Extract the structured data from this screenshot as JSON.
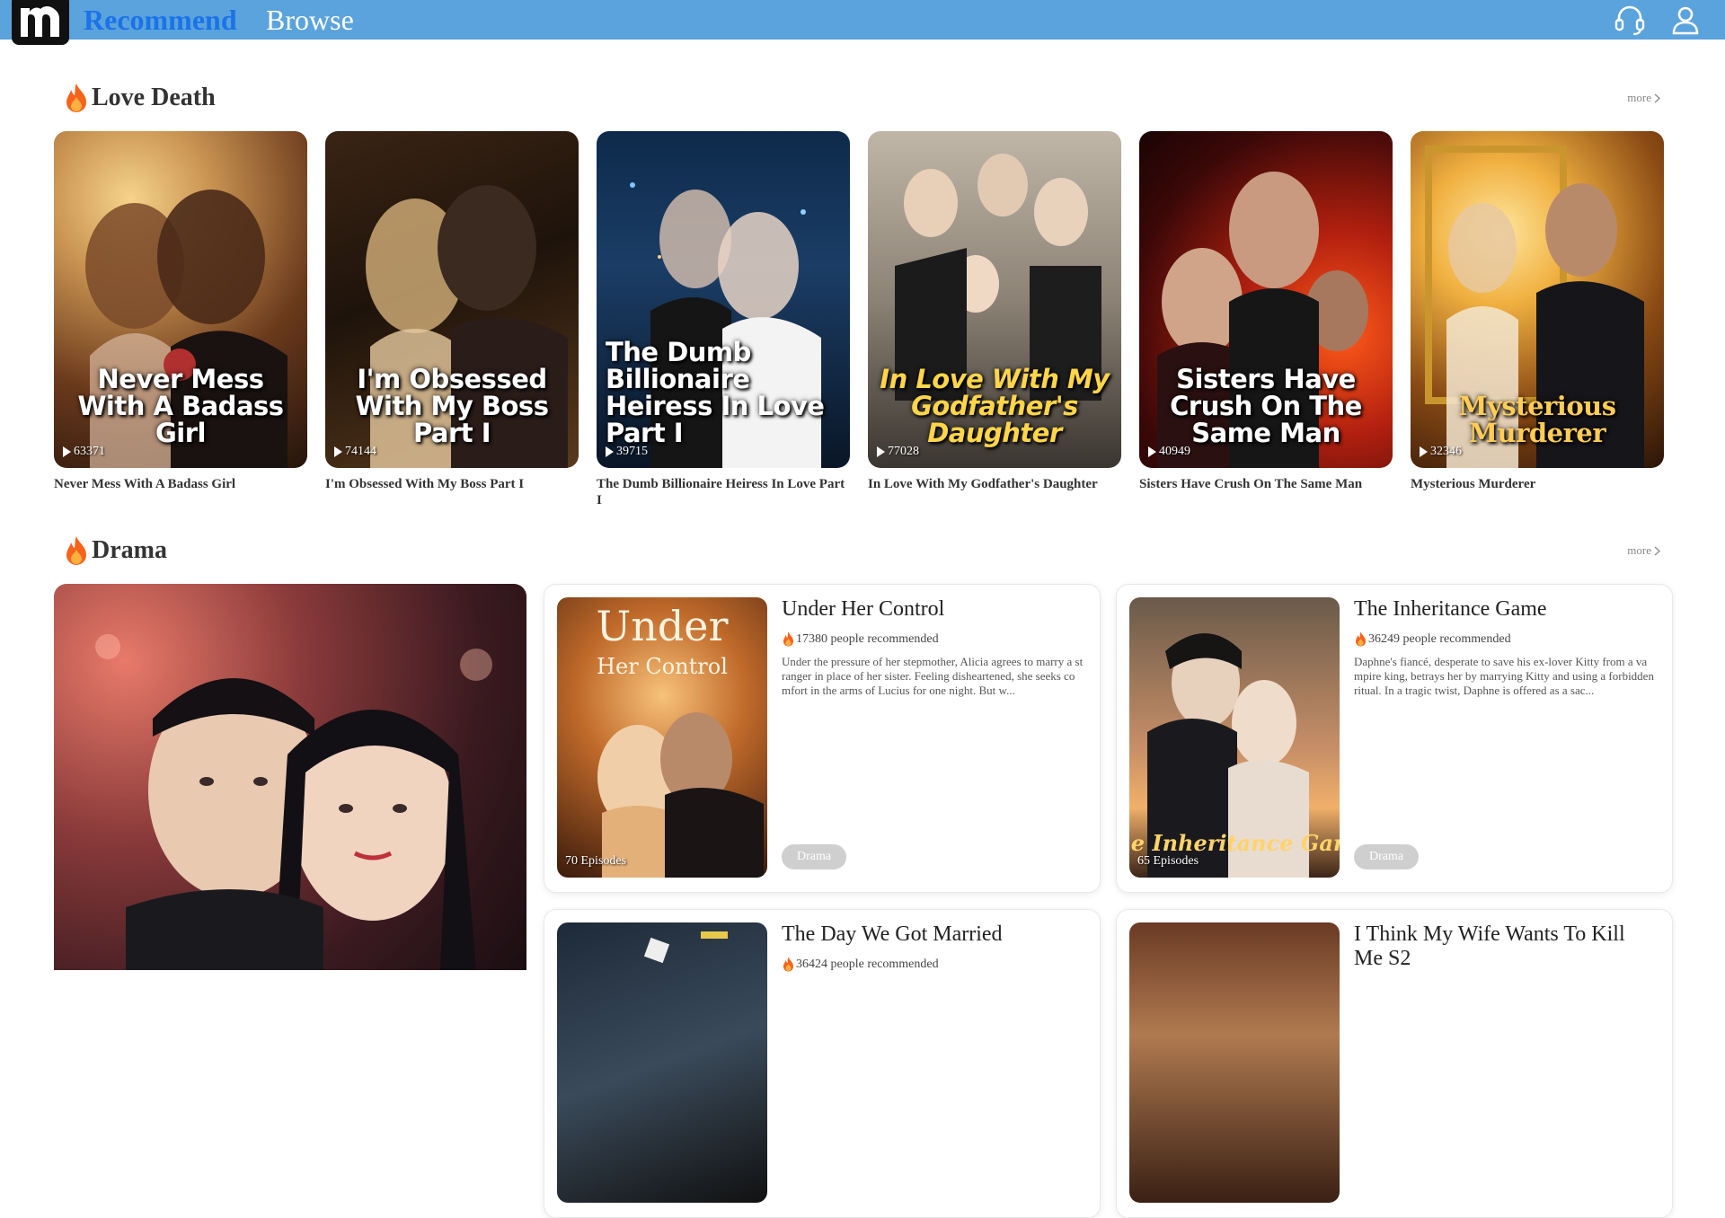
{
  "header": {
    "logo_letter": "m",
    "tabs": [
      {
        "label": "Recommend",
        "active": true
      },
      {
        "label": "Browse",
        "active": false
      }
    ],
    "icons": [
      "headset-icon",
      "user-icon"
    ],
    "bar_color": "#5ba3dc",
    "active_tab_color": "#1a73e8"
  },
  "sections": [
    {
      "title": "Love Death",
      "more": "more",
      "items": [
        {
          "name": "Never Mess With A Badass Girl",
          "poster_text": "Never Mess With A Badass Girl",
          "plays": "63371"
        },
        {
          "name": "I'm Obsessed With My Boss Part I",
          "poster_text": "I'm Obsessed With My Boss Part I",
          "plays": "74144"
        },
        {
          "name": "The Dumb Billionaire Heiress In Love Part I",
          "poster_text": "The Dumb Billionaire Heiress In Love Part I",
          "plays": "39715"
        },
        {
          "name": "In Love With My Godfather's Daughter",
          "poster_text": "In Love With My Godfather's Daughter",
          "plays": "77028"
        },
        {
          "name": "Sisters Have Crush On The Same Man",
          "poster_text": "Sisters Have Crush On The Same Man",
          "plays": "40949"
        },
        {
          "name": "Mysterious Murderer",
          "poster_text": "Mysterious Murderer",
          "plays": "32346"
        }
      ]
    },
    {
      "title": "Drama",
      "more": "more",
      "items": [
        {
          "title": "Under Her Control",
          "poster_text": "Under Her Control",
          "recommended": "17380 people recommended",
          "description": "Under the pressure of her stepmother, Alicia agrees to marry a stranger in place of her sister. Feeling disheartened, she seeks comfort in the arms of Lucius for one night. But w...",
          "episodes": "70 Episodes",
          "tag": "Drama"
        },
        {
          "title": "The Inheritance Game",
          "poster_text": "The Inheritance Game",
          "recommended": "36249 people recommended",
          "description": "Daphne's fiancé, desperate to save his ex-lover Kitty from a vampire king, betrays her by marrying Kitty and using a forbidden ritual. In a tragic twist, Daphne is offered as a sac...",
          "episodes": "65 Episodes",
          "tag": "Drama"
        },
        {
          "title": "The Day We Got Married",
          "recommended": "36424 people recommended"
        },
        {
          "title": "I Think My Wife Wants To Kill Me S2"
        }
      ]
    }
  ]
}
